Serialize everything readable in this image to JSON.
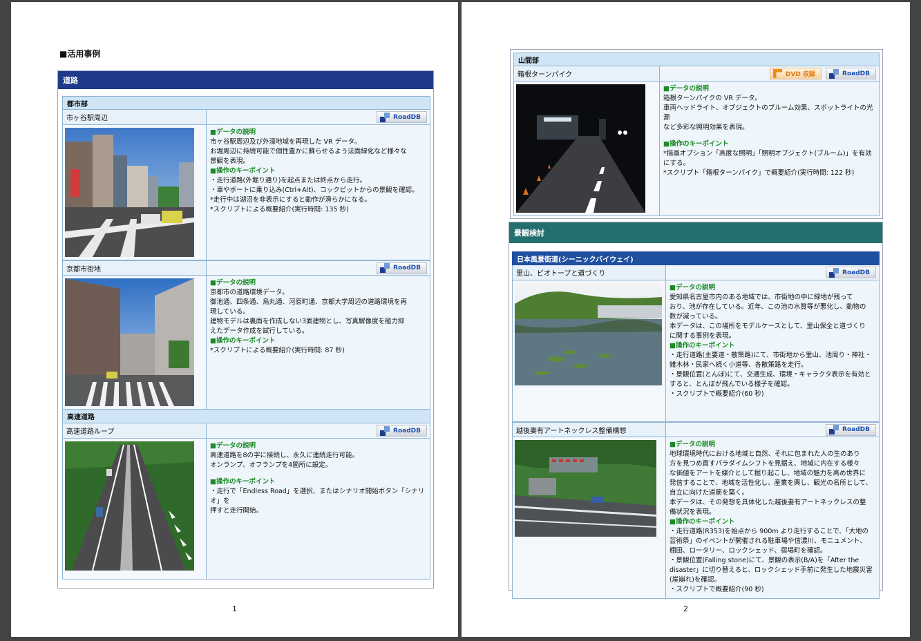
{
  "page1": {
    "heading": "■活用事例",
    "section_title": "道路",
    "number": "1",
    "groups": [
      {
        "title": "都市部",
        "name": "市ヶ谷駅周辺",
        "badge": "RoadDB",
        "desc_title": "■データの説明",
        "desc": [
          "市ヶ谷駅周辺及び外濠地域を再現した VR データ。",
          "お堀周辺に持続可能で個性豊かに蘇らせるよう法面緑化など様々な",
          "景観を表現。"
        ],
        "ops_title": "■操作のキーポイント",
        "ops": [
          "・走行道路(外堀り通り)を起点または終点から走行。",
          "・車やボートに乗り込み(Ctrl+Alt)、コックピットからの景観を確認。",
          "*走行中は湖沼を非表示にすると動作が滑らかになる。",
          "*スクリプトによる概要紹介(実行時間: 135 秒)"
        ]
      },
      {
        "title": "",
        "name": "京都市街地",
        "badge": "RoadDB",
        "desc_title": "■データの説明",
        "desc": [
          "京都市の道路環境データ。",
          "御池通、四条通、烏丸通、河原町通、京都大学周辺の道路環境を再",
          "現している。",
          "建物モデルは裏面を作成しない3面建物とし、写真解像度を極力抑",
          "えたデータ作成を試行している。"
        ],
        "ops_title": "■操作のキーポイント",
        "ops": [
          "*スクリプトによる概要紹介(実行時間: 87 秒)"
        ]
      },
      {
        "title": "高速道路",
        "name": "高速道路ループ",
        "badge": "RoadDB",
        "desc_title": "■データの説明",
        "desc": [
          "高速道路を8の字に接続し、永久に連続走行可能。",
          "オンランプ、オフランプを4箇所に設定。"
        ],
        "ops_title": "■操作のキーポイント",
        "ops": [
          "・走行で「Endless Road」を選択、またはシナリオ開始ボタン「シナリオ」を",
          "押すと走行開始。"
        ]
      }
    ]
  },
  "page2": {
    "number": "2",
    "mountain": {
      "title": "山間部",
      "name": "箱根ターンパイク",
      "badge_dvd": "DVD 収録",
      "badge": "RoadDB",
      "desc_title": "■データの説明",
      "desc": [
        "箱根ターンパイクの VR データ。",
        "車両ヘッドライト、オブジェクトのブルーム効果、スポットライトの光源",
        "など多彩な照明効果を表現。"
      ],
      "ops_title": "■操作のキーポイント",
      "ops": [
        "*描画オプション「高度な照明」「照明オブジェクト(ブルーム)」を有効",
        "にする。",
        "*スクリプト「箱根ターンパイク」で概要紹介(実行時間: 122 秒)"
      ]
    },
    "section_title": "景観検討",
    "subgroup_title": "日本風景街道(シーニックバイウェイ)",
    "items": [
      {
        "name": "里山、ビオトープと道づくり",
        "badge": "RoadDB",
        "desc_title": "■データの説明",
        "desc": [
          "愛知県名古屋市内のある地域では、市街地の中に緑地が残って",
          "おり、池が存在している。近年、この池の水質等が悪化し、動物の",
          "数が減っている。",
          "本データは、この場所をモデルケースとして、里山保全と道づくり",
          "に関する事例を表現。"
        ],
        "ops_title": "■操作のキーポイント",
        "ops": [
          "・走行道路(主要道・散策路)にて、市街地から里山、池周り・神社・",
          "雑木林・民家へ続く小道等、各散策路を走行。",
          "・景観位置(とんぼ)にて、交通生成、環境・キャラクタ表示を有効と",
          "すると、とんぼが飛んでいる様子を確認。",
          "・スクリプトで概要紹介(60 秒)"
        ]
      },
      {
        "name": "越後妻有アートネックレス整備構想",
        "badge": "RoadDB",
        "desc_title": "■データの説明",
        "desc": [
          "地球環境時代における地域と自然、それに包まれた人の生のあり",
          "方を見つめ直すパラダイムシフトを見据え、地域に内在する様々",
          "な価値をアートを媒介として掘り起こし、地域の魅力を高め世界に",
          "発信することで、地域を活性化し、産業を興し、観光の名所として、",
          "自立に向けた道筋を築く。",
          "本データは、その発想を具体化した越後妻有アートネックレスの整",
          "備状況を表現。"
        ],
        "ops_title": "■操作のキーポイント",
        "ops": [
          "・走行道路(R353)を始点から 900m より走行することで、「大地の",
          "芸術祭」のイベントが開催される駐車場や信濃川、モニュメント、",
          "棚田、ロータリー、ロックシェッド、宿場町を確認。",
          "・景観位置(Falling stone)にて、景観の表示(B/A)を「After the",
          "disaster」に切り替えると、ロックシェッド手前に発生した地震災害",
          "(崖崩れ)を確認。",
          "・スクリプトで概要紹介(90 秒)"
        ]
      }
    ]
  }
}
